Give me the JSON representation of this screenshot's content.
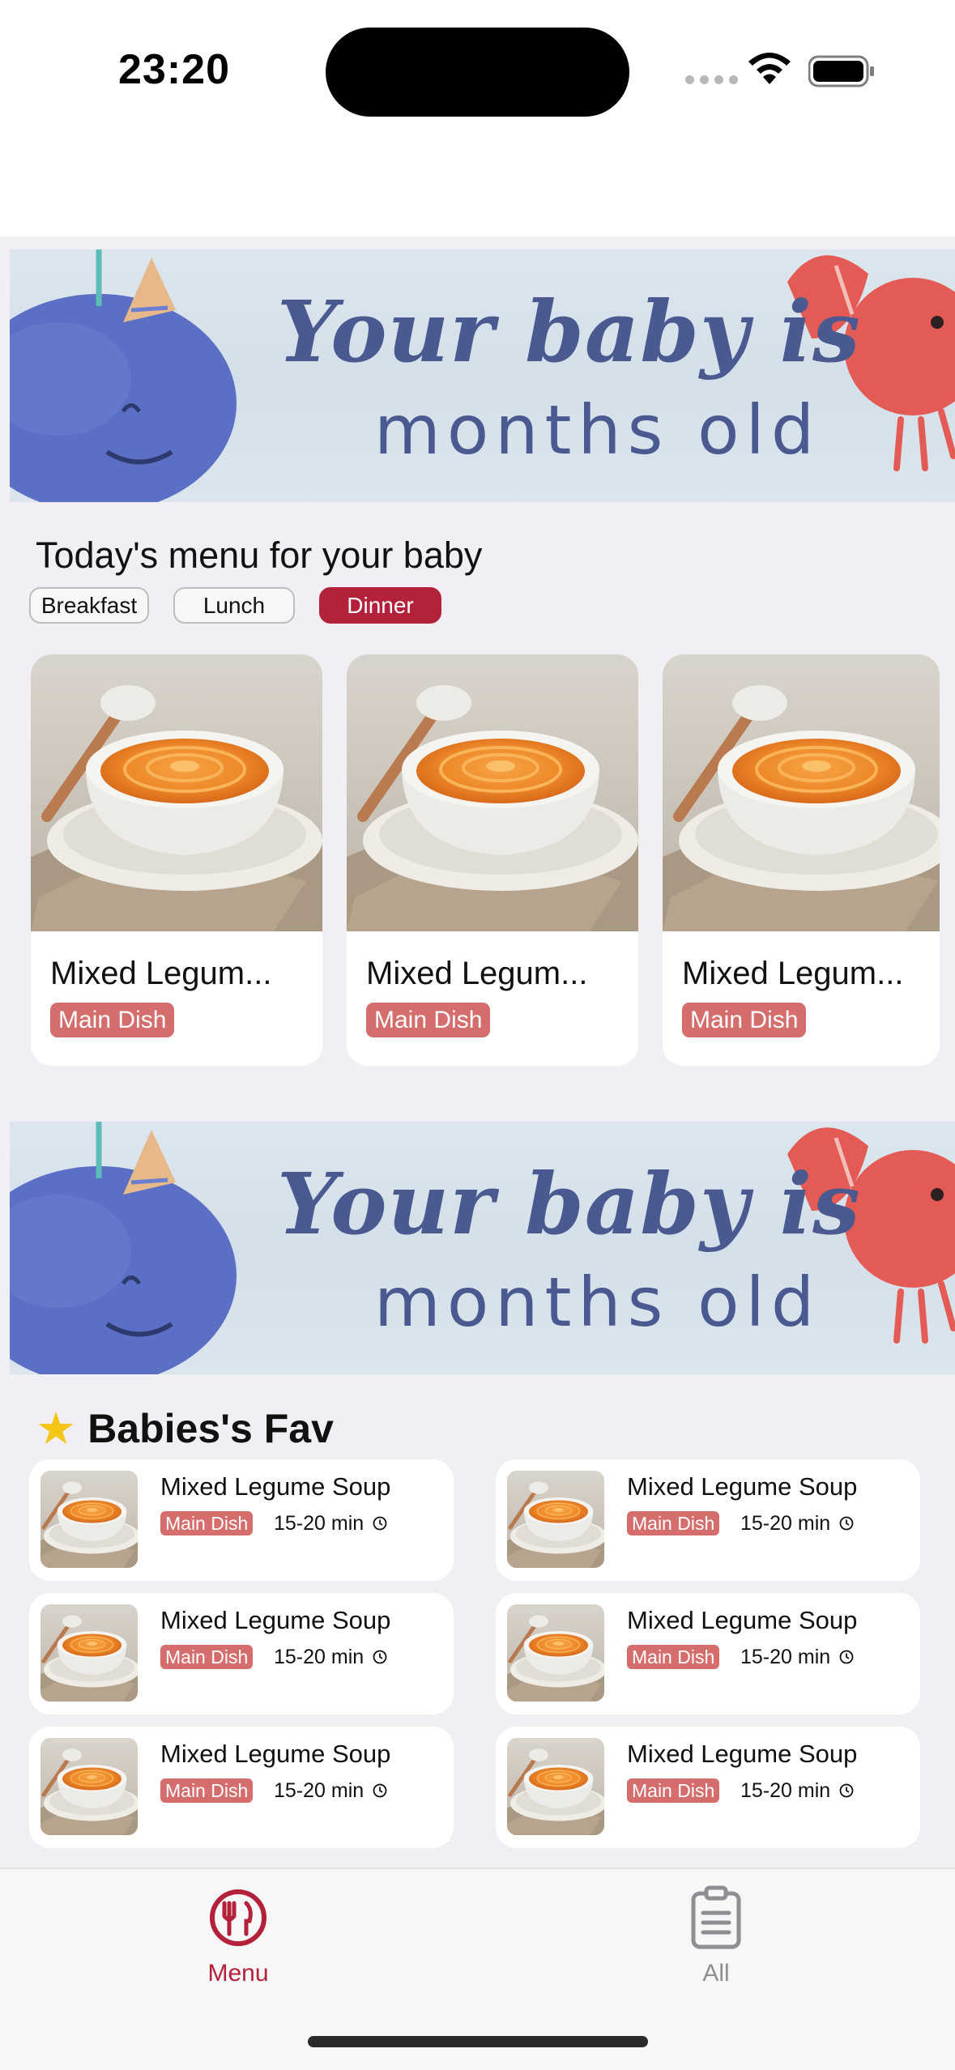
{
  "status_bar": {
    "time": "23:20"
  },
  "banner": {
    "line1": "Your baby is",
    "line2": "months old"
  },
  "menu_section": {
    "title": "Today's menu for your baby",
    "meal_tabs": [
      {
        "label": "Breakfast",
        "active": false
      },
      {
        "label": "Lunch",
        "active": false
      },
      {
        "label": "Dinner",
        "active": true
      }
    ],
    "cards": [
      {
        "name": "Mixed Legum...",
        "tag": "Main Dish"
      },
      {
        "name": "Mixed Legum...",
        "tag": "Main Dish"
      },
      {
        "name": "Mixed Legum...",
        "tag": "Main Dish"
      }
    ]
  },
  "favorites": {
    "title": "Babies's Fav",
    "items": [
      {
        "name": "Mixed Legume Soup",
        "tag": "Main Dish",
        "duration": "15-20 min"
      },
      {
        "name": "Mixed Legume Soup",
        "tag": "Main Dish",
        "duration": "15-20 min"
      },
      {
        "name": "Mixed Legume Soup",
        "tag": "Main Dish",
        "duration": "15-20 min"
      },
      {
        "name": "Mixed Legume Soup",
        "tag": "Main Dish",
        "duration": "15-20 min"
      },
      {
        "name": "Mixed Legume Soup",
        "tag": "Main Dish",
        "duration": "15-20 min"
      },
      {
        "name": "Mixed Legume Soup",
        "tag": "Main Dish",
        "duration": "15-20 min"
      }
    ]
  },
  "tab_bar": {
    "tabs": [
      {
        "label": "Menu",
        "icon": "fork-knife-icon",
        "active": true
      },
      {
        "label": "All",
        "icon": "clipboard-icon",
        "active": false
      }
    ]
  },
  "colors": {
    "accent": "#b3213a",
    "tag": "#d56d6d",
    "background": "#f1eff4",
    "inactive_tab": "#8e8e93"
  }
}
